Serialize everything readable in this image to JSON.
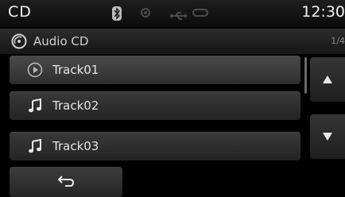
{
  "status_bar": {
    "title": "CD",
    "time": "12:30",
    "icons": [
      "bluetooth-icon",
      "disc-status-icon",
      "usb-icon",
      "ipod-icon"
    ]
  },
  "source": {
    "label": "Audio CD",
    "page": "1/4",
    "icon": "disc-icon"
  },
  "tracks": [
    {
      "label": "Track01",
      "icon": "play-circle-icon",
      "selected": true
    },
    {
      "label": "Track02",
      "icon": "music-note-icon",
      "selected": false
    },
    {
      "label": "Track03",
      "icon": "music-note-icon",
      "selected": false
    }
  ],
  "controls": {
    "scroll_up_icon": "triangle-up-icon",
    "scroll_down_icon": "triangle-down-icon",
    "back_icon": "back-arrow-icon"
  },
  "colors": {
    "background": "#000000",
    "row": "#2e2e2e",
    "text": "#e6e6e6",
    "inactive_icon": "#4c4c4c"
  }
}
